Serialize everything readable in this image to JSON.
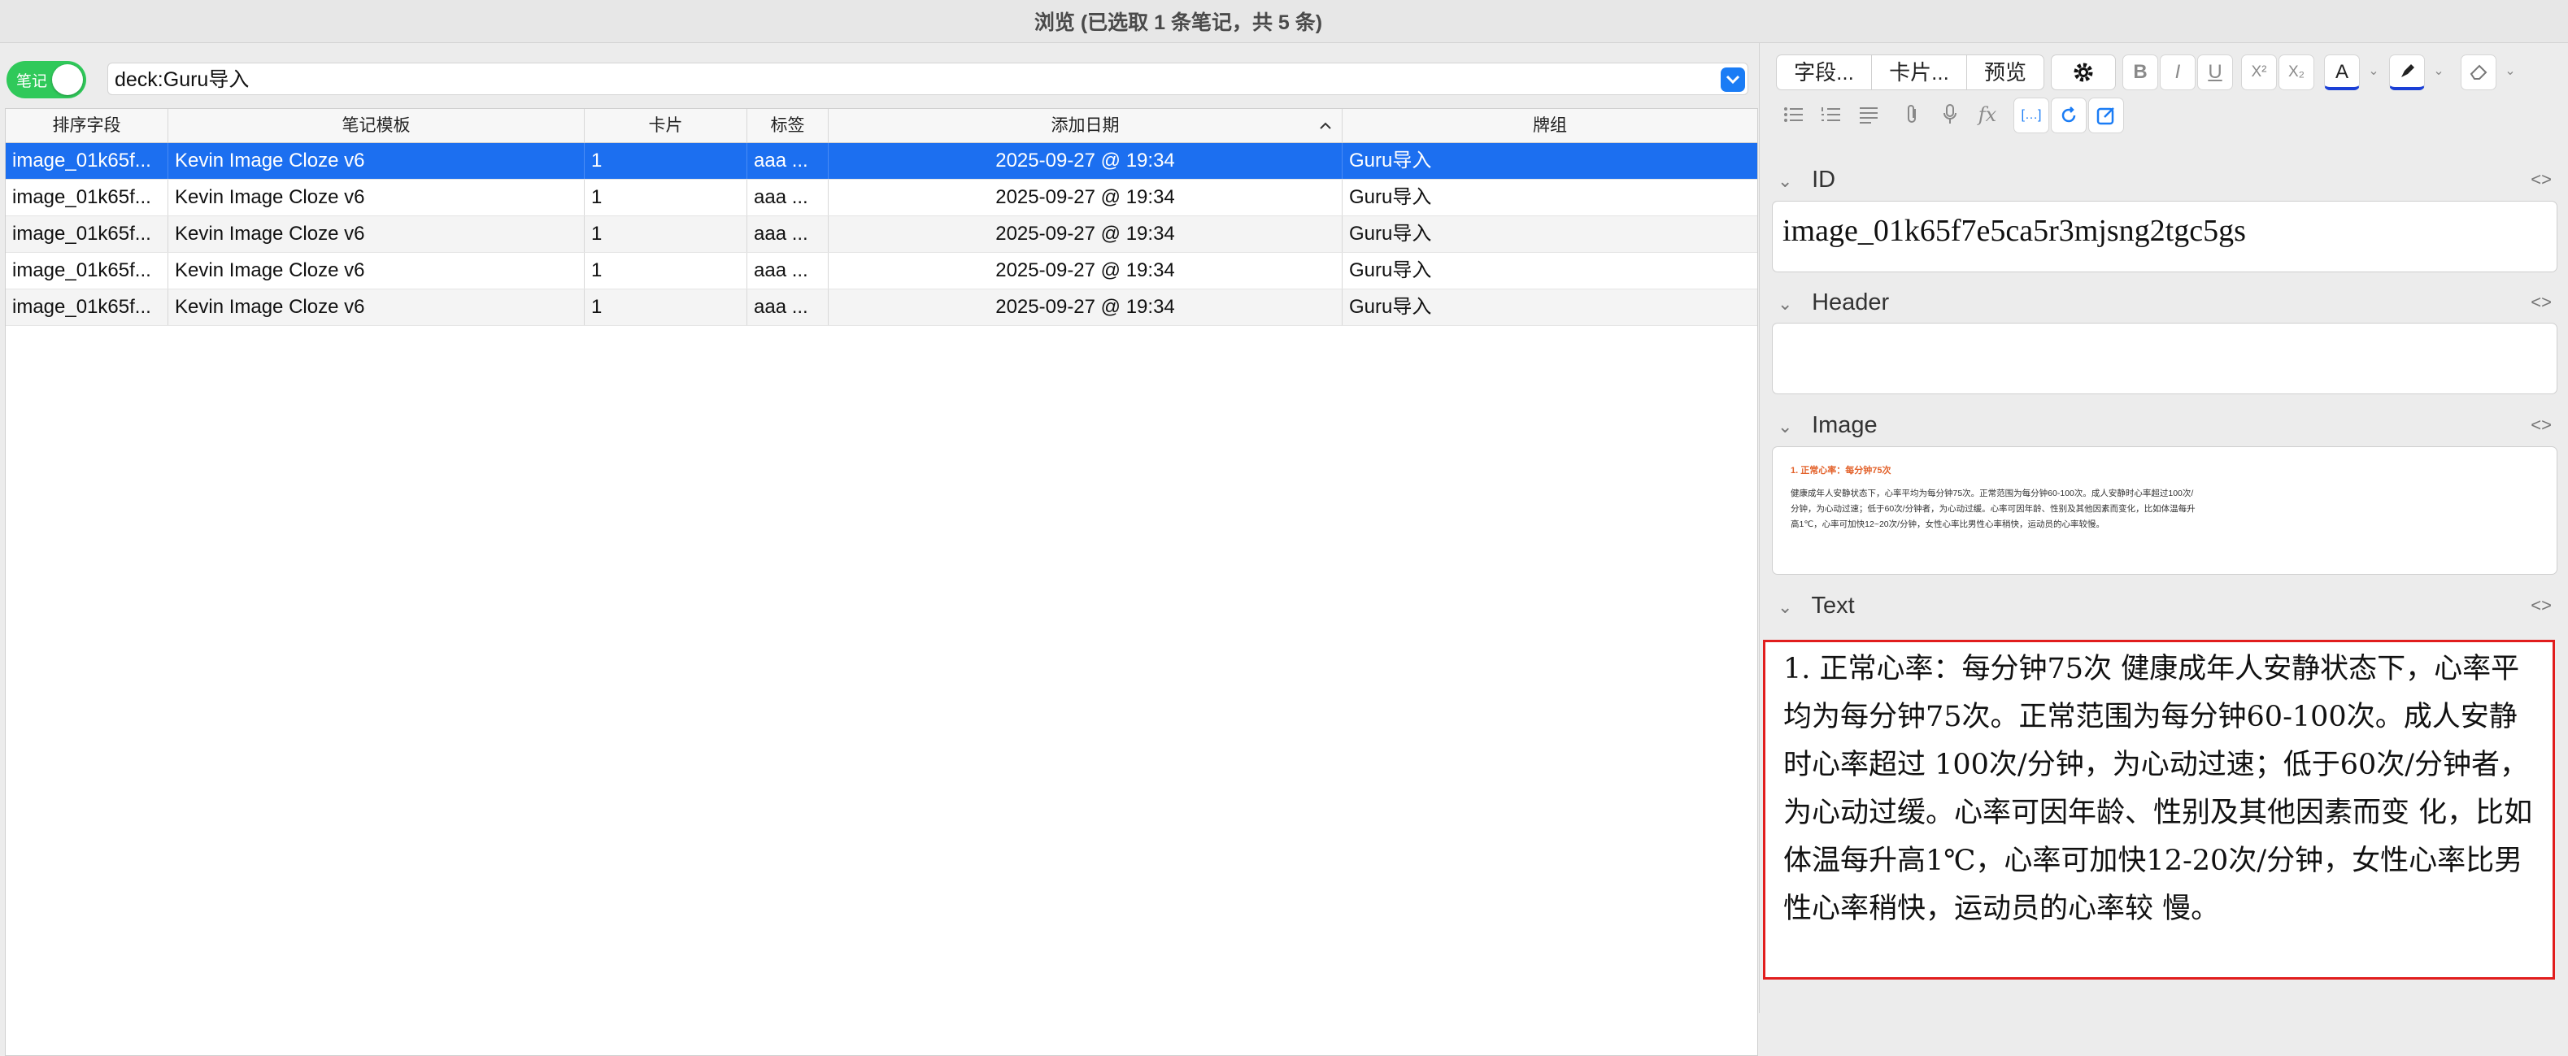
{
  "window": {
    "title": "浏览 (已选取 1 条笔记，共 5 条)"
  },
  "toggle": {
    "label": "笔记",
    "on": true,
    "color": "#30c95a"
  },
  "search": {
    "value": "deck:Guru导入"
  },
  "table": {
    "columns": [
      "排序字段",
      "笔记模板",
      "卡片",
      "标签",
      "添加日期",
      "牌组"
    ],
    "sort_indicator": "^",
    "rows": [
      {
        "sort_field": "image_01k65f...",
        "template": "Kevin Image Cloze v6",
        "cards": "1",
        "tags": "aaa ...",
        "date": "2025-09-27 @ 19:34",
        "deck": "Guru导入",
        "selected": true
      },
      {
        "sort_field": "image_01k65f...",
        "template": "Kevin Image Cloze v6",
        "cards": "1",
        "tags": "aaa ...",
        "date": "2025-09-27 @ 19:34",
        "deck": "Guru导入",
        "selected": false
      },
      {
        "sort_field": "image_01k65f...",
        "template": "Kevin Image Cloze v6",
        "cards": "1",
        "tags": "aaa ...",
        "date": "2025-09-27 @ 19:34",
        "deck": "Guru导入",
        "selected": false
      },
      {
        "sort_field": "image_01k65f...",
        "template": "Kevin Image Cloze v6",
        "cards": "1",
        "tags": "aaa ...",
        "date": "2025-09-27 @ 19:34",
        "deck": "Guru导入",
        "selected": false
      },
      {
        "sort_field": "image_01k65f...",
        "template": "Kevin Image Cloze v6",
        "cards": "1",
        "tags": "aaa ...",
        "date": "2025-09-27 @ 19:34",
        "deck": "Guru导入",
        "selected": false
      }
    ]
  },
  "editor": {
    "buttons": {
      "fields": "字段...",
      "cards": "卡片...",
      "preview": "预览"
    },
    "toolbar_icons": [
      "gear-icon",
      "bold-icon",
      "italic-icon",
      "underline-icon",
      "superscript-icon",
      "subscript-icon",
      "text-color-icon",
      "highlight-icon",
      "eraser-icon",
      "bullet-list-icon",
      "numbered-list-icon",
      "align-icon",
      "attachment-icon",
      "microphone-icon",
      "function-icon",
      "cloze-icon",
      "refresh-icon",
      "edit-icon"
    ],
    "format_labels": {
      "bold": "B",
      "italic": "I",
      "underline": "U",
      "sup": "X²",
      "sub": "X₂",
      "color": "A",
      "fx": "fx",
      "cloze": "[…]"
    },
    "code_toggle": "<>",
    "fields": [
      {
        "name": "ID",
        "value": "image_01k65f7e5ca5r3mjsng2tgc5gs"
      },
      {
        "name": "Header",
        "value": ""
      },
      {
        "name": "Image",
        "value": ""
      },
      {
        "name": "Text",
        "value": "1. 正常心率：每分钟75次 健康成年人安静状态下，心率平均为每分钟75次。正常范围为每分钟60-100次。成人安静时心率超过 100次/分钟，为心动过速；低于60次/分钟者，为心动过缓。心率可因年龄、性别及其他因素而变 化，比如体温每升高1℃，心率可加快12-20次/分钟，女性心率比男性心率稍快，运动员的心率较 慢。"
      }
    ],
    "image_preview": {
      "title": "1. 正常心率：每分钟75次",
      "body": "健康成年人安静状态下，心率平均为每分钟75次。正常范围为每分钟60-100次。成人安静时心率超过100次/分钟，为心动过速；低于60次/分钟者，为心动过缓。心率可因年龄、性别及其他因素而变化，比如体温每升高1℃，心率可加快12~20次/分钟，女性心率比男性心率稍快，运动员的心率较慢。"
    }
  }
}
